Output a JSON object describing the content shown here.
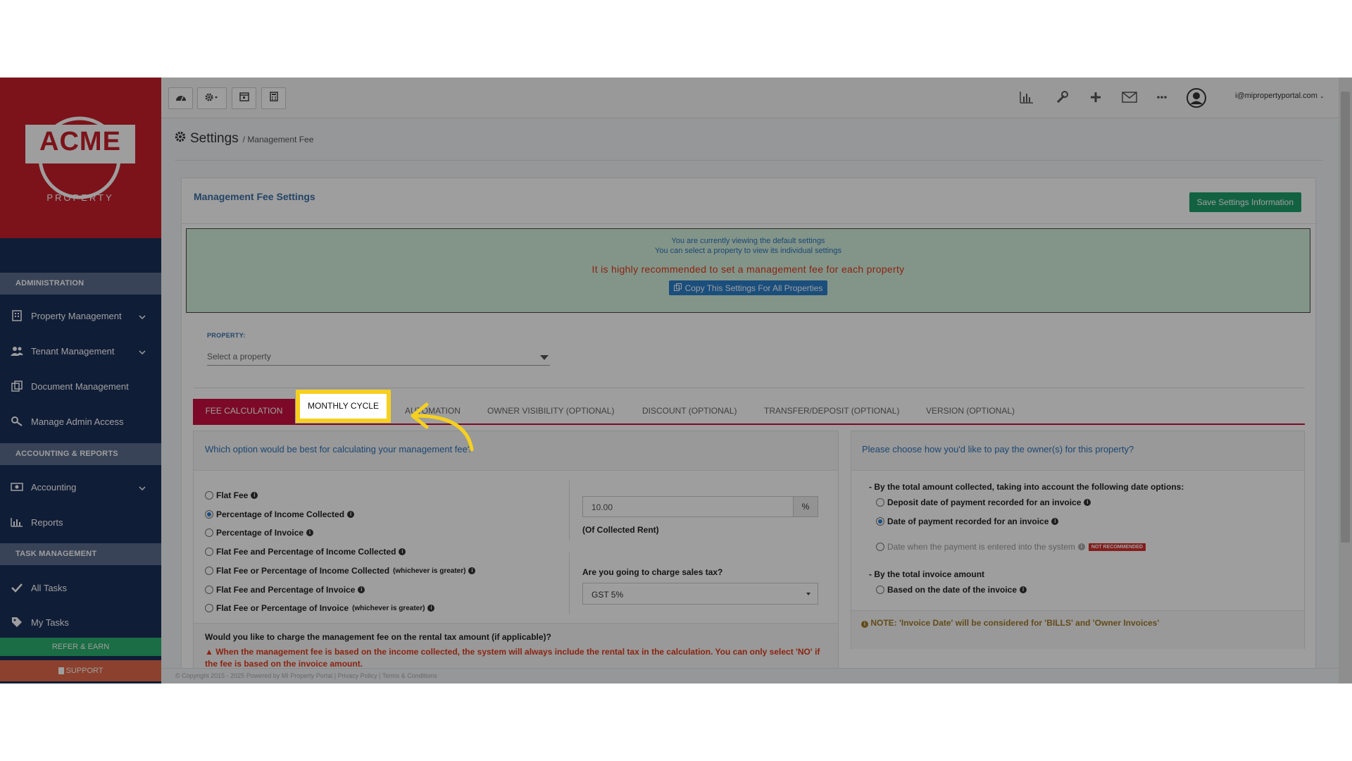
{
  "sidebar": {
    "logo_text": "ACME",
    "logo_sub": "PROPERTY",
    "sections": {
      "admin": "ADMINISTRATION",
      "accounting": "ACCOUNTING & REPORTS",
      "tasks": "TASK MANAGEMENT"
    },
    "items": {
      "property": "Property Management",
      "tenant": "Tenant Management",
      "document": "Document Management",
      "admin_access": "Manage Admin Access",
      "accounting": "Accounting",
      "reports": "Reports",
      "all_tasks": "All Tasks",
      "my_tasks": "My Tasks"
    },
    "refer": "REFER & EARN",
    "support": "SUPPORT"
  },
  "topbar": {
    "user_email": "i@mipropertyportal.com"
  },
  "breadcrumb": {
    "title": "Settings",
    "sub": "/ Management Fee"
  },
  "panel": {
    "title": "Management Fee Settings",
    "save_label": "Save Settings Information",
    "notice_line1": "You are currently viewing the default settings",
    "notice_line2": "You can select a property to view its individual settings",
    "notice_warning": "It is highly recommended to set a management fee for each property",
    "copy_label": "Copy This Settings For All Properties",
    "property_label": "PROPERTY:",
    "property_placeholder": "Select a property"
  },
  "tabs": {
    "fee_calc": "FEE CALCULATION",
    "monthly": "MONTHLY CYCLE",
    "automation": "AUTOMATION",
    "owner_vis": "OWNER VISIBILITY (OPTIONAL)",
    "discount": "DISCOUNT (OPTIONAL)",
    "transfer": "TRANSFER/DEPOSIT (OPTIONAL)",
    "version": "VERSION (OPTIONAL)"
  },
  "calc": {
    "question": "Which option would be best for calculating your management fee?",
    "options": [
      {
        "label": "Flat Fee",
        "note": ""
      },
      {
        "label": "Percentage of Income Collected",
        "note": ""
      },
      {
        "label": "Percentage of Invoice",
        "note": ""
      },
      {
        "label": "Flat Fee and Percentage of Income Collected",
        "note": ""
      },
      {
        "label": "Flat Fee or Percentage of Income Collected",
        "note": "(whichever is greater)"
      },
      {
        "label": "Flat Fee and Percentage of Invoice",
        "note": ""
      },
      {
        "label": "Flat Fee or Percentage of Invoice",
        "note": "(whichever is greater)"
      }
    ],
    "selected_index": 1,
    "percent_value": "10.00",
    "percent_symbol": "%",
    "of_collected": "(Of Collected Rent)",
    "tax_question": "Are you going to charge sales tax?",
    "tax_value": "GST 5%",
    "rental_tax_question": "Would you like to charge the management fee on the rental tax amount (if applicable)?",
    "rental_tax_warning": "When the management fee is based on the income collected, the system will always include the rental tax in the calculation. You can only select 'NO' if the fee is based on the invoice amount."
  },
  "pay": {
    "question": "Please choose how you'd like to pay the owner(s) for this property?",
    "group1": "- By the total amount collected, taking into account the following date options:",
    "opt_deposit": "Deposit date of payment recorded for an invoice",
    "opt_date_payment": "Date of payment recorded for an invoice",
    "opt_entered": "Date when the payment is entered into the system",
    "not_recommended": "NOT RECOMMENDED",
    "group2": "- By the total invoice amount",
    "opt_invoice": "Based on the date of the invoice",
    "note": "NOTE: 'Invoice Date' will be considered for 'BILLS' and 'Owner Invoices'"
  },
  "footer": {
    "text": "© Copyright 2015 - 2025 Powered by MI Property Portal | Privacy Policy | Terms & Conditions"
  },
  "colors": {
    "sidebar": "#1b2f5a",
    "logo_bg": "#c8202a",
    "tab_active": "#c8103f",
    "highlight": "#f5d020",
    "save": "#1e9e6b"
  }
}
